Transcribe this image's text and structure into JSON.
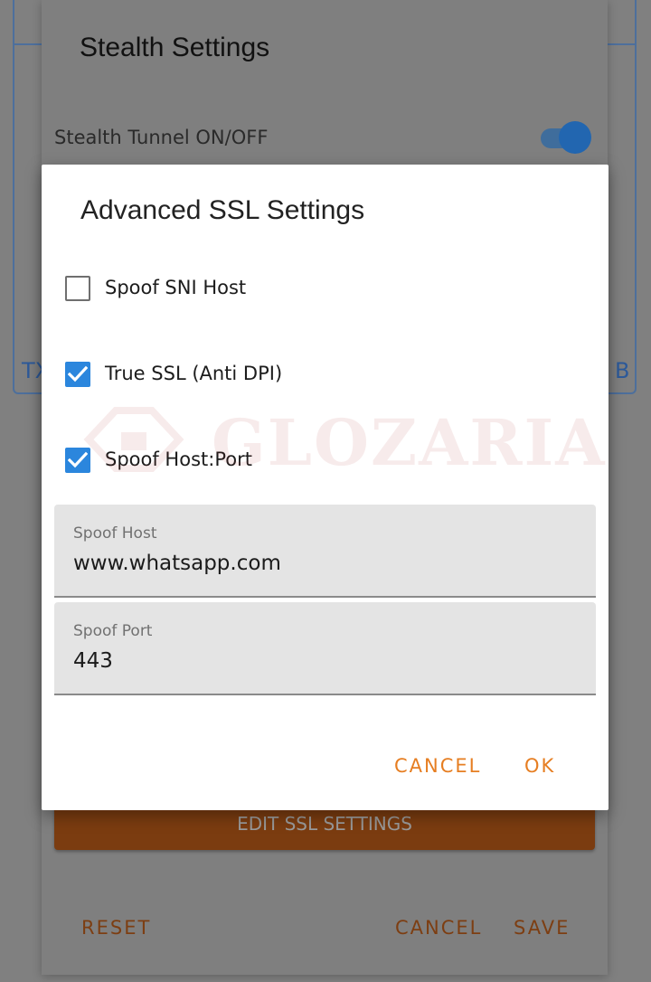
{
  "colors": {
    "accent_orange": "#e67e22",
    "checkbox_blue": "#2b86dd",
    "toggle_blue": "#2266b0",
    "edit_button_bg": "#7b3c10"
  },
  "background": {
    "tx_label": "TX",
    "b_label": "B"
  },
  "stealth_dialog": {
    "title": "Stealth Settings",
    "toggle_label": "Stealth Tunnel ON/OFF",
    "toggle_on": true,
    "edit_ssl_button": "EDIT SSL SETTINGS",
    "reset_label": "RESET",
    "cancel_label": "CANCEL",
    "save_label": "SAVE"
  },
  "ssl_dialog": {
    "title": "Advanced SSL Settings",
    "options": [
      {
        "label": "Spoof SNI Host",
        "checked": false
      },
      {
        "label": "True SSL (Anti DPI)",
        "checked": true
      },
      {
        "label": "Spoof Host:Port",
        "checked": true
      }
    ],
    "spoof_host": {
      "label": "Spoof Host",
      "value": "www.whatsapp.com"
    },
    "spoof_port": {
      "label": "Spoof Port",
      "value": "443"
    },
    "cancel_label": "CANCEL",
    "ok_label": "OK"
  },
  "watermark": {
    "text": "GLOZARIA"
  }
}
